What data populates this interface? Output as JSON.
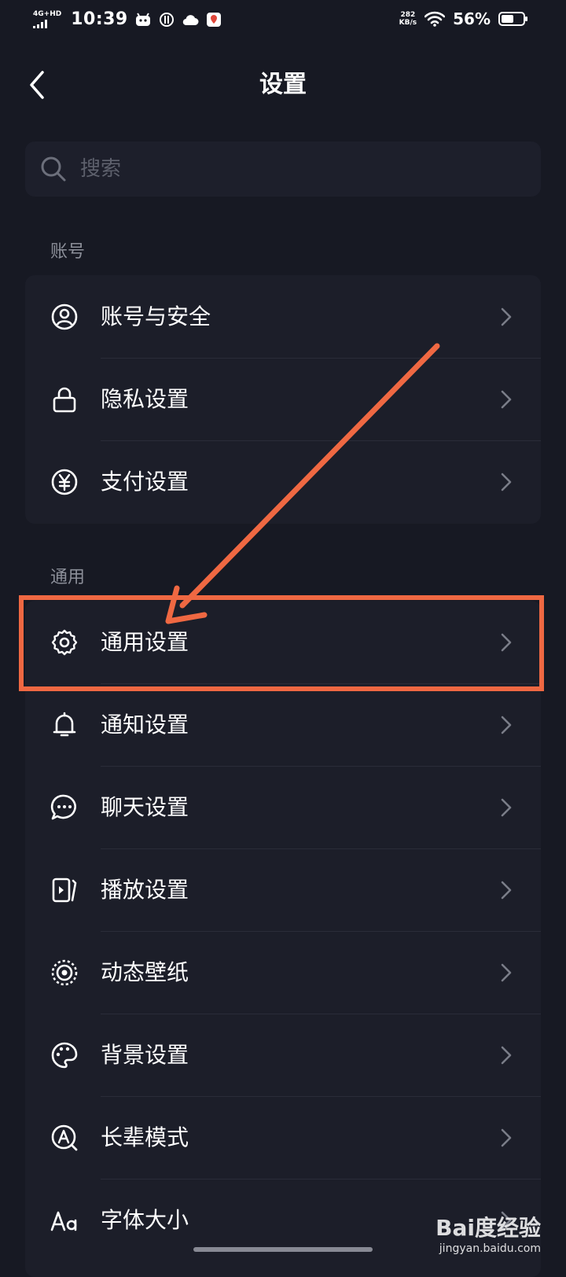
{
  "status_bar": {
    "network": "4G+HD",
    "time": "10:39",
    "speed_value": "282",
    "speed_unit": "KB/s",
    "battery_percent": "56%",
    "battery_level": 0.56
  },
  "header": {
    "title": "设置"
  },
  "search": {
    "placeholder": "搜索"
  },
  "sections": {
    "account": {
      "label": "账号",
      "items": [
        {
          "label": "账号与安全",
          "icon": "user-icon"
        },
        {
          "label": "隐私设置",
          "icon": "lock-icon"
        },
        {
          "label": "支付设置",
          "icon": "yen-icon"
        }
      ]
    },
    "general": {
      "label": "通用",
      "items": [
        {
          "label": "通用设置",
          "icon": "gear-icon"
        },
        {
          "label": "通知设置",
          "icon": "bell-icon"
        },
        {
          "label": "聊天设置",
          "icon": "chat-icon"
        },
        {
          "label": "播放设置",
          "icon": "play-icon"
        },
        {
          "label": "动态壁纸",
          "icon": "wallpaper-icon"
        },
        {
          "label": "背景设置",
          "icon": "palette-icon"
        },
        {
          "label": "长辈模式",
          "icon": "elder-mode-icon"
        },
        {
          "label": "字体大小",
          "icon": "font-size-icon"
        }
      ]
    }
  },
  "watermark": {
    "brand": "Bai度经验",
    "url": "jingyan.baidu.com"
  },
  "colors": {
    "background": "#171923",
    "card": "#1c1e29",
    "annotation": "#ef6842"
  }
}
